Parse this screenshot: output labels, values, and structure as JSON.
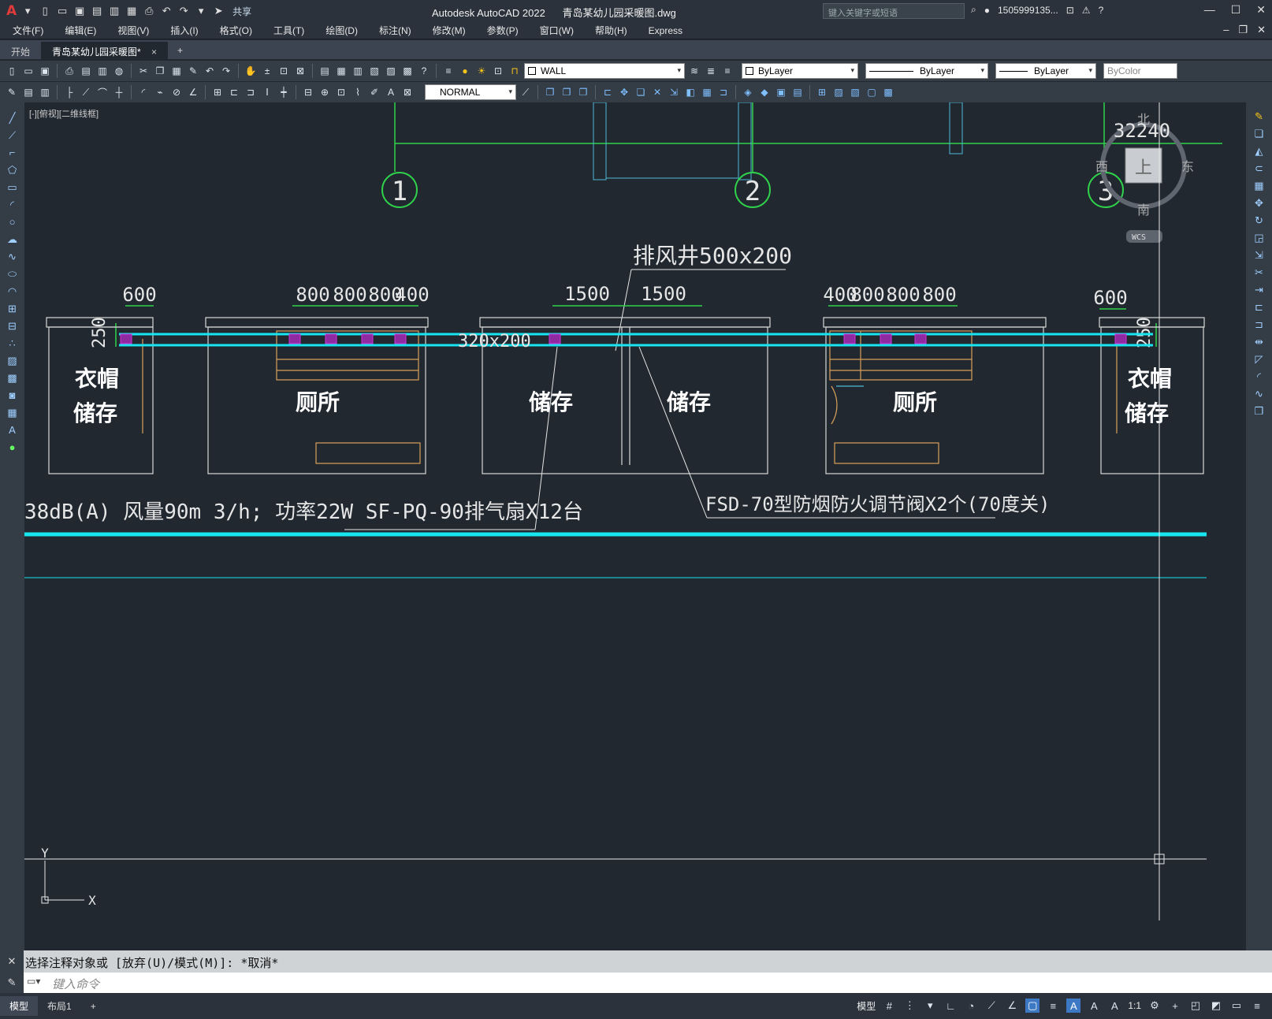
{
  "titlebar": {
    "app_name": "Autodesk AutoCAD 2022",
    "doc_name": "青岛某幼儿园采暖图.dwg",
    "share_label": "共享",
    "search_placeholder": "键入关键字或短语",
    "user": "1505999135..."
  },
  "menu": [
    "文件(F)",
    "编辑(E)",
    "视图(V)",
    "插入(I)",
    "格式(O)",
    "工具(T)",
    "绘图(D)",
    "标注(N)",
    "修改(M)",
    "参数(P)",
    "窗口(W)",
    "帮助(H)",
    "Express"
  ],
  "tabs": {
    "start": "开始",
    "doc": "青岛某幼儿园采暖图*",
    "close": "×",
    "add": "+"
  },
  "toolbar1": {
    "layer": "WALL",
    "color": "ByLayer",
    "linetype": "ByLayer",
    "lineweight": "ByLayer",
    "plotstyle": "ByColor"
  },
  "toolbar2": {
    "style": "NORMAL"
  },
  "viewport": {
    "label": "[-][俯视][二维线框]"
  },
  "viewcube": {
    "north": "北",
    "south": "南",
    "east": "东",
    "west": "西",
    "top": "上",
    "wcs": "WCS"
  },
  "drawing": {
    "dim_top": "32240",
    "grid_marks": [
      "1",
      "2",
      "3"
    ],
    "exhaust_shaft": "排风井500x200",
    "duct_size": "320x200",
    "dims_a": [
      "600"
    ],
    "dims_b": [
      "800",
      "800",
      "800",
      "400"
    ],
    "dims_c": [
      "1500",
      "1500"
    ],
    "dims_d": [
      "400",
      "800",
      "800",
      "800"
    ],
    "dims_e": [
      "600"
    ],
    "side_dim": "250",
    "rooms": [
      "衣帽",
      "储存",
      "厕所",
      "储存",
      "储存",
      "厕所",
      "衣帽",
      "储存"
    ],
    "fan_note": "38dB(A) 风量90m 3/h; 功率22W SF-PQ-90排气扇X12台",
    "damper_note": "FSD-70型防烟防火调节阀X2个(70度关)",
    "ucs_x": "X",
    "ucs_y": "Y"
  },
  "command": {
    "history": "选择注释对象或 [放弃(U)/模式(M)]: *取消*",
    "placeholder": "键入命令"
  },
  "status": {
    "tabs": [
      "模型",
      "布局1",
      "+"
    ],
    "model_label": "模型",
    "scale": "1:1"
  }
}
